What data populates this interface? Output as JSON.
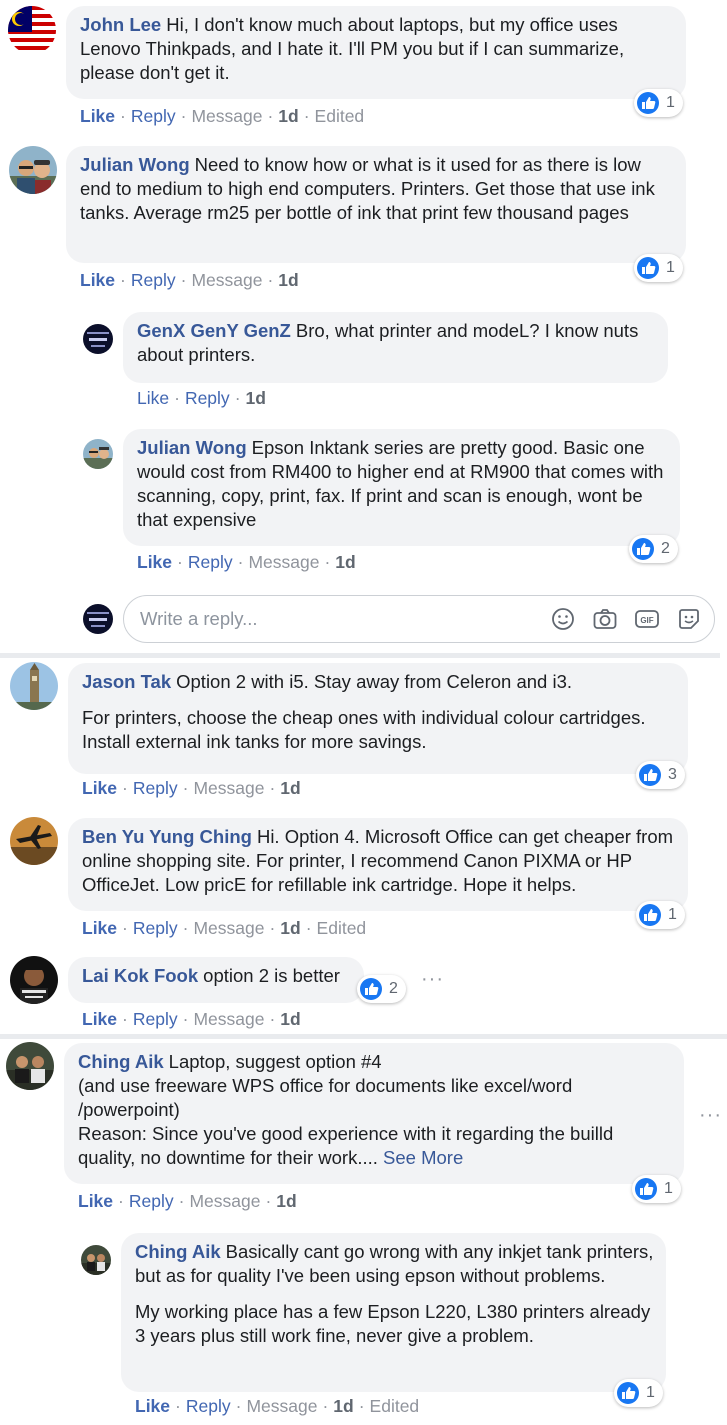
{
  "comments": [
    {
      "name": "John Lee",
      "text": "Hi, I don't know much about laptops, but my office uses Lenovo Thinkpads, and I hate it. I'll PM you but if I can summarize, please don't get it.",
      "actions": {
        "like": "Like",
        "reply": "Reply",
        "message": "Message",
        "time": "1d",
        "edited": "Edited"
      },
      "reactions": "1"
    },
    {
      "name": "Julian Wong",
      "text": "Need to know how or what is it used for as there is low end to medium to high end computers. Printers. Get those that use ink tanks. Average rm25 per bottle of ink that print few thousand pages",
      "actions": {
        "like": "Like",
        "reply": "Reply",
        "message": "Message",
        "time": "1d"
      },
      "reactions": "1",
      "replies": [
        {
          "name": "GenX GenY GenZ",
          "text": "Bro, what printer and modeL? I know nuts about printers.",
          "actions": {
            "like": "Like",
            "reply": "Reply",
            "time": "1d"
          }
        },
        {
          "name": "Julian Wong",
          "text": "Epson Inktank series are pretty good. Basic one would cost from RM400 to higher end at RM900 that comes with scanning, copy, print, fax. If print and scan is enough, wont be that expensive",
          "actions": {
            "like": "Like",
            "reply": "Reply",
            "message": "Message",
            "time": "1d"
          },
          "reactions": "2"
        }
      ],
      "reply_box": {
        "placeholder": "Write a reply..."
      }
    },
    {
      "name": "Jason Tak",
      "text": "Option 2 with i5. Stay away from Celeron and i3.",
      "text2": "For printers, choose the cheap ones with individual colour cartridges. Install external ink tanks for more savings.",
      "actions": {
        "like": "Like",
        "reply": "Reply",
        "message": "Message",
        "time": "1d"
      },
      "reactions": "3"
    },
    {
      "name": "Ben Yu Yung Ching",
      "text": "Hi. Option 4. Microsoft Office can get cheaper from online shopping site. For printer, I recommend Canon PIXMA or HP OfficeJet. Low pricE for refillable ink cartridge. Hope it helps.",
      "actions": {
        "like": "Like",
        "reply": "Reply",
        "message": "Message",
        "time": "1d",
        "edited": "Edited"
      },
      "reactions": "1"
    },
    {
      "name": "Lai Kok Fook",
      "text": "option 2 is better",
      "actions": {
        "like": "Like",
        "reply": "Reply",
        "message": "Message",
        "time": "1d"
      },
      "reactions": "2",
      "more": "···"
    },
    {
      "name": "Ching Aik",
      "text": "Laptop, suggest option #4",
      "line2": "(and use freeware WPS office for documents like excel/word /powerpoint)",
      "line3": "Reason: Since you've good experience with it regarding the builld quality, no downtime for their work....",
      "see_more": "See More",
      "actions": {
        "like": "Like",
        "reply": "Reply",
        "message": "Message",
        "time": "1d"
      },
      "reactions": "1",
      "more": "···",
      "replies": [
        {
          "name": "Ching Aik",
          "text": "Basically cant go wrong with any inkjet tank printers, but as for quality I've been using epson without problems.",
          "text2": "My working place has a few Epson L220, L380 printers already 3 years plus still work fine, never give a problem.",
          "actions": {
            "like": "Like",
            "reply": "Reply",
            "message": "Message",
            "time": "1d",
            "edited": "Edited"
          },
          "reactions": "1"
        }
      ]
    }
  ],
  "colors": {
    "link": "#385898",
    "like": "#4267b2",
    "bubble": "#f2f3f5",
    "meta": "#90949c",
    "thumb": "#1877f2"
  }
}
